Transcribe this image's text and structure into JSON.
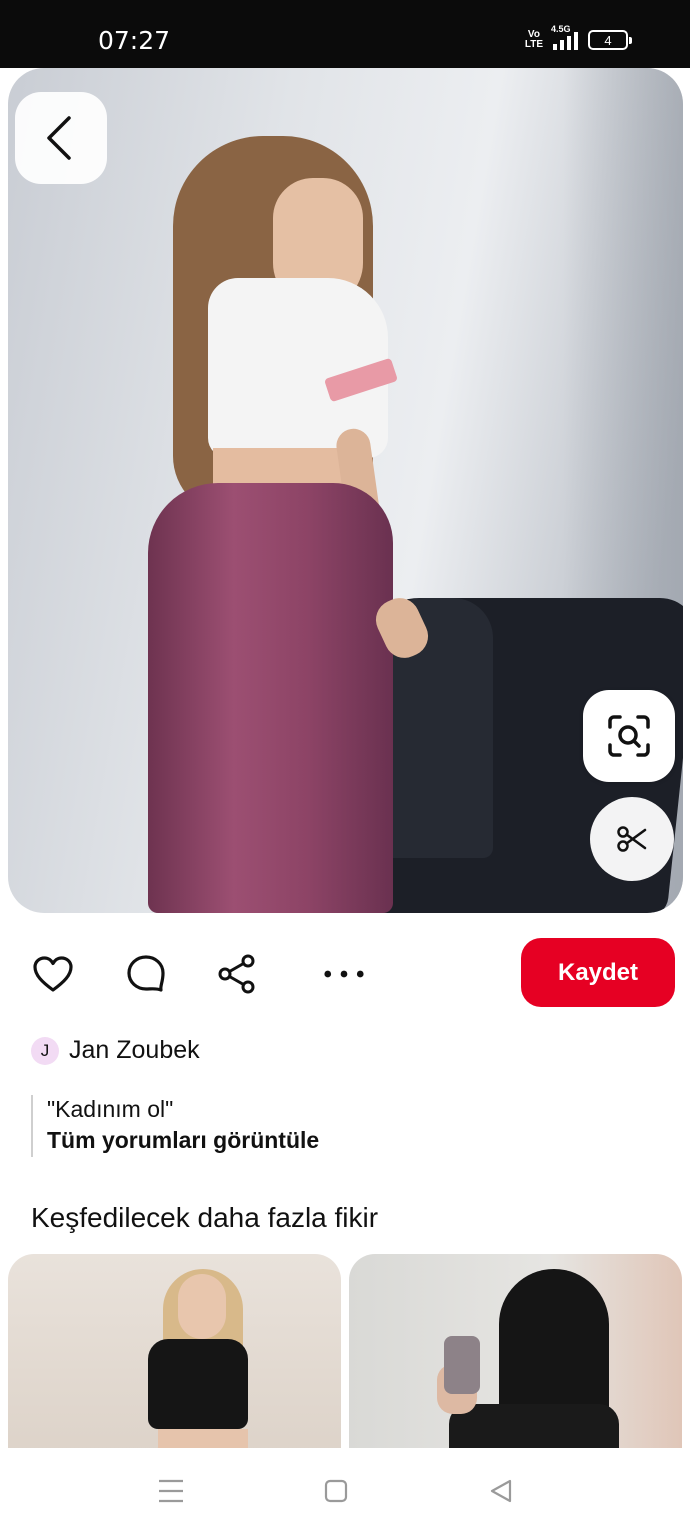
{
  "status_bar": {
    "time": "07:27",
    "volte": "Vo\nLTE",
    "network": "4.5G",
    "battery": "4"
  },
  "pin": {
    "image_icons": [
      "back-arrow-icon",
      "visual-search-icon",
      "scissors-icon"
    ]
  },
  "actions": {
    "icons": [
      "heart-icon",
      "comment-icon",
      "share-icon",
      "more-icon"
    ],
    "save_label": "Kaydet",
    "save_color": "#e60023"
  },
  "author": {
    "initial": "J",
    "name": "Jan Zoubek"
  },
  "comment": {
    "text": "\"Kadınım ol\"",
    "view_all": "Tüm yorumları görüntüle"
  },
  "more_ideas": {
    "title": "Keşfedilecek daha fazla fikir"
  },
  "nav": {
    "icons": [
      "menu-icon",
      "home-icon",
      "back-icon"
    ]
  }
}
